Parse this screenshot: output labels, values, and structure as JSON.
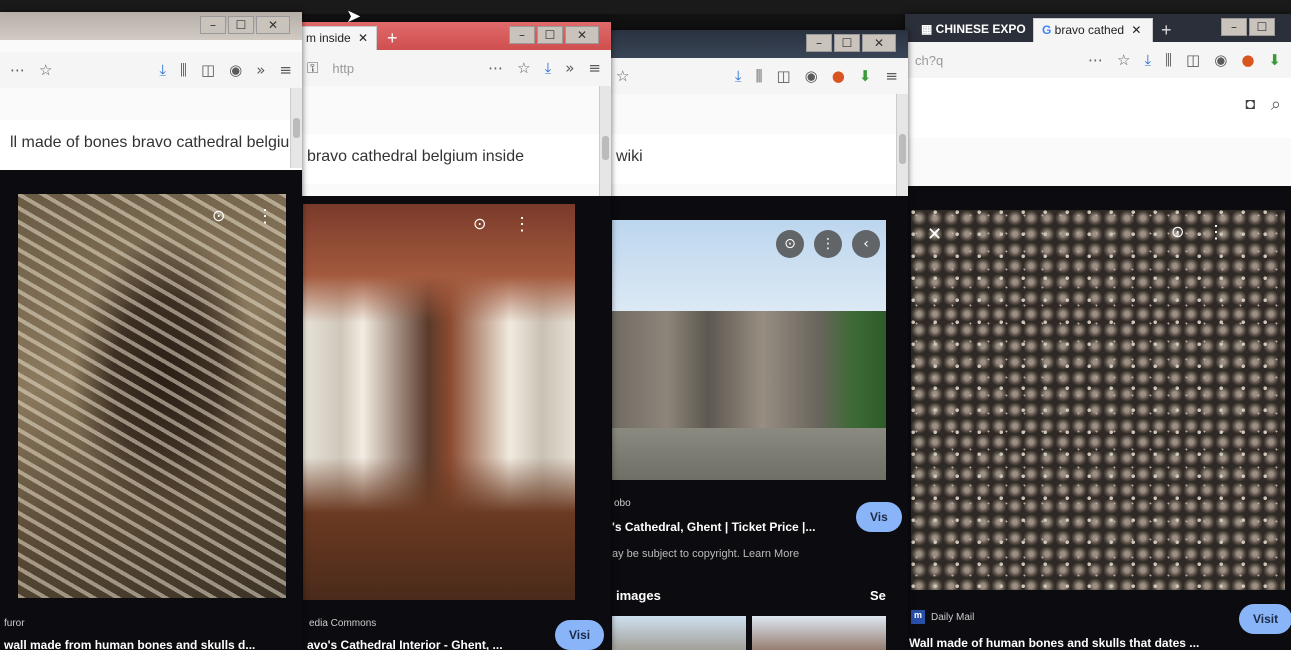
{
  "windows": {
    "w1": {
      "search_text": "ll made of bones bravo cathedral belgiu",
      "source": "furor",
      "title": "wall made from human bones and skulls d..."
    },
    "w2": {
      "tab_label": "m inside",
      "url": "http",
      "search_text": "bravo cathedral belgium inside",
      "source": "edia Commons",
      "title": "avo's Cathedral Interior - Ghent, ...",
      "visit_label": "Visi"
    },
    "w3": {
      "search_text": "wiki",
      "source": "obo",
      "title": "'s Cathedral, Ghent | Ticket Price |...",
      "notice": "ay be subject to copyright. Learn More",
      "related_label": "images",
      "see_label": "Se",
      "visit_label": "Vis"
    },
    "w4": {
      "tab1_label": "CHINESE EXPO",
      "tab2_label": "bravo cathed",
      "url": "ch?q",
      "source": "Daily Mail",
      "title": "Wall made of human bones and skulls that dates ...",
      "visit_label": "Visit"
    }
  },
  "icons": {
    "more": "⋯",
    "star": "☆",
    "download": "⤓",
    "library": "⫼",
    "sidebar": "◫",
    "account": "◉",
    "overflow": "»",
    "menu": "≡",
    "minimize": "–",
    "maximize": "☐",
    "close": "✕",
    "lock": "🔒",
    "lens": "⊙",
    "kebab": "⋮",
    "back": "‹",
    "camera": "◘",
    "search": "⌕",
    "new_tab": "+"
  },
  "colors": {
    "results_bg": "#0c0c10",
    "visit_button": "#8ab4f8",
    "titlebar": "#d8d2cb",
    "dark_tab": "#2b2f3a"
  }
}
